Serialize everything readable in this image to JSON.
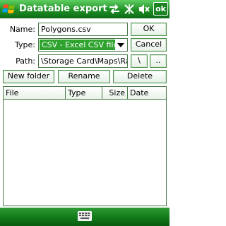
{
  "window": {
    "title": "Datatable export",
    "ok_badge": "ok",
    "status_icons": [
      "windows-logo-icon",
      "connectivity-icon",
      "no-signal-icon",
      "volume-muted-icon"
    ]
  },
  "form": {
    "name": {
      "label": "Name:",
      "value": "Polygons.csv"
    },
    "type": {
      "label": "Type:",
      "value": "CSV - Excel CSV files"
    },
    "path": {
      "label": "Path:",
      "value": "\\Storage Card\\Maps\\Ras"
    },
    "ok_label": "OK",
    "cancel_label": "Cancel",
    "root_button": "\\",
    "up_button": ".."
  },
  "actions": {
    "new_folder": "New folder",
    "rename": "Rename",
    "delete": "Delete"
  },
  "file_list": {
    "columns": [
      "File",
      "Type",
      "Size",
      "Date"
    ],
    "rows": []
  },
  "bottom_bar": {
    "icon": "keyboard-icon"
  },
  "colors": {
    "titlebar": "#1f8f26",
    "selection": "#2ea32e",
    "border": "#4a7a4a"
  }
}
